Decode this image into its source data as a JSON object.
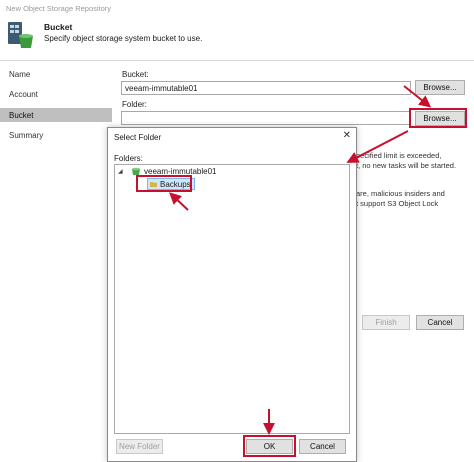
{
  "window": {
    "title": "New Object Storage Repository"
  },
  "header": {
    "title": "Bucket",
    "subtitle": "Specify object storage system bucket to use."
  },
  "nav": {
    "items": [
      "Name",
      "Account",
      "Bucket",
      "Summary"
    ],
    "active_index": 2
  },
  "form": {
    "bucket_label": "Bucket:",
    "bucket_value": "veeam-immutable01",
    "bucket_browse_label": "Browse...",
    "folder_label": "Folder:",
    "folder_value": "",
    "folder_browse_label": "Browse..."
  },
  "background_text": {
    "line1": "pecified limit is exceeded,",
    "line2": "t, no new tasks will be started.",
    "line3": "are, malicious insiders and",
    "line4": "t support S3 Object Lock"
  },
  "footer": {
    "finish_label": "Finish",
    "cancel_label": "Cancel"
  },
  "dialog": {
    "title": "Select Folder",
    "close_glyph": "✕",
    "folders_label": "Folders:",
    "tree": {
      "expand_glyph": "◢",
      "root": "veeam-immutable01",
      "child": "Backups"
    },
    "new_folder_label": "New Folder",
    "ok_label": "OK",
    "cancel_label": "Cancel"
  },
  "colors": {
    "highlight": "#c8102e",
    "selection": "#cde8ff",
    "nav_active": "#bfbfbf"
  },
  "icons": {
    "header": "storage-bucket-icon",
    "tree_root": "bucket-icon",
    "tree_child": "folder-icon"
  }
}
